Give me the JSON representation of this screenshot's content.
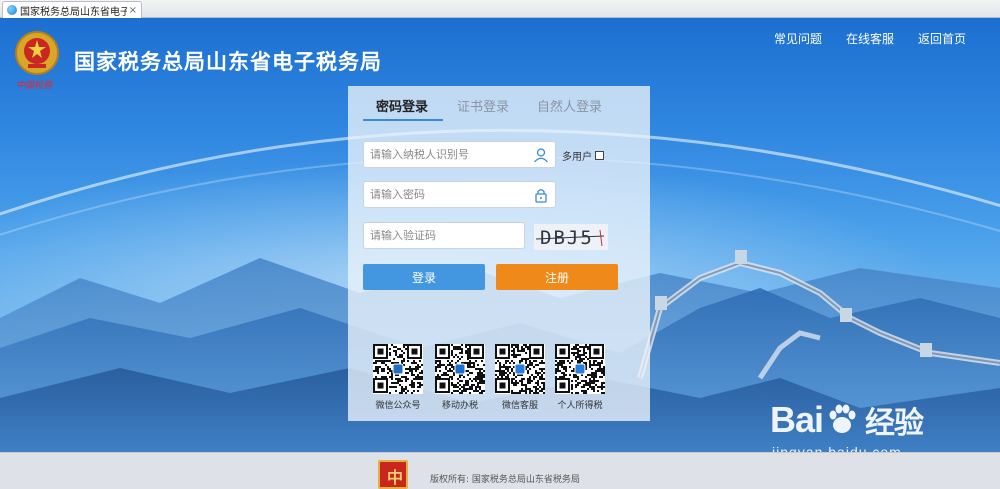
{
  "browser": {
    "tab_title": "国家税务总局山东省电子税...",
    "tab_close": "×"
  },
  "header": {
    "emblem_icon": "tax-emblem-icon",
    "logo_script": "中國稅務",
    "site_title": "国家税务总局山东省电子税务局",
    "nav": [
      "常见问题",
      "在线客服",
      "返回首页"
    ]
  },
  "login": {
    "tabs": [
      "密码登录",
      "证书登录",
      "自然人登录"
    ],
    "active_tab": "密码登录",
    "taxpayer_id_placeholder": "请输入纳税人识别号",
    "password_placeholder": "请输入密码",
    "captcha_placeholder": "请输入验证码",
    "multi_user_label": "多用户",
    "multi_user_checked": false,
    "captcha_text": "DBJ5",
    "login_button": "登录",
    "register_button": "注册",
    "accent_color": "#4297e0",
    "register_color": "#ef8a1a"
  },
  "qrcodes": [
    {
      "label": "微信公众号",
      "icon": "wechat-official-qr-icon"
    },
    {
      "label": "移动办税",
      "icon": "mobile-tax-qr-icon"
    },
    {
      "label": "微信客服",
      "icon": "wechat-service-qr-icon"
    },
    {
      "label": "个人所得税",
      "icon": "personal-income-tax-qr-icon"
    }
  ],
  "footer": {
    "copyright": "版权所有: 国家税务总局山东省税务局",
    "logo_glyph": "中"
  },
  "watermark": {
    "brand_left": "Bai",
    "brand_right": "经验",
    "url": "jingyan.baidu.com"
  }
}
